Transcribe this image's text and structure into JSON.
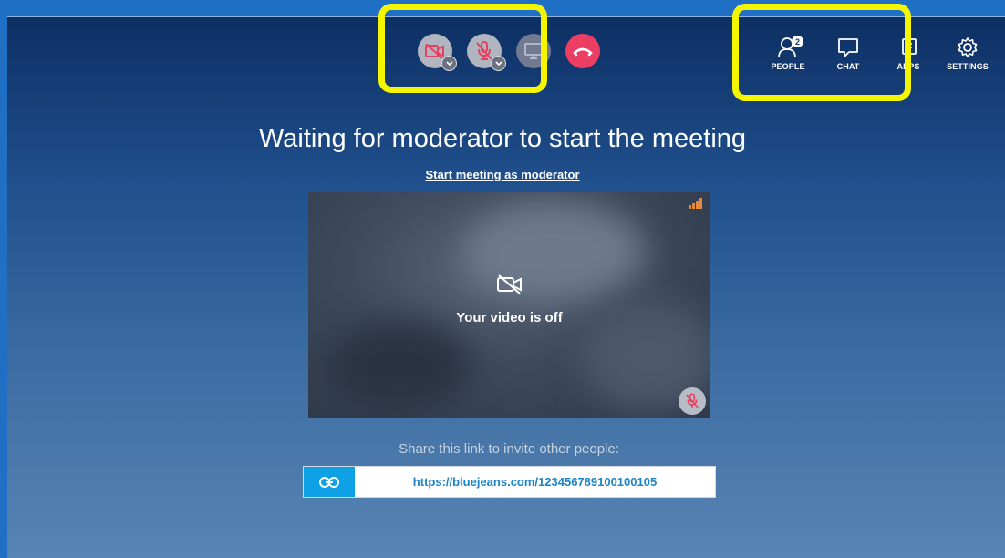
{
  "toolbar": {
    "people_label": "PEOPLE",
    "people_count": "2",
    "chat_label": "CHAT",
    "apps_label": "APPS",
    "settings_label": "SETTINGS"
  },
  "main": {
    "title": "Waiting for moderator to start the meeting",
    "start_link": "Start meeting as moderator",
    "video_off_text": "Your video is off",
    "share_label": "Share this link to invite other people:",
    "share_url": "https://bluejeans.com/123456789100100105"
  },
  "colors": {
    "highlight": "#f5f500",
    "hangup": "#ec3d62",
    "mute_red": "#e8415f",
    "link_accent": "#0ea1e6"
  }
}
